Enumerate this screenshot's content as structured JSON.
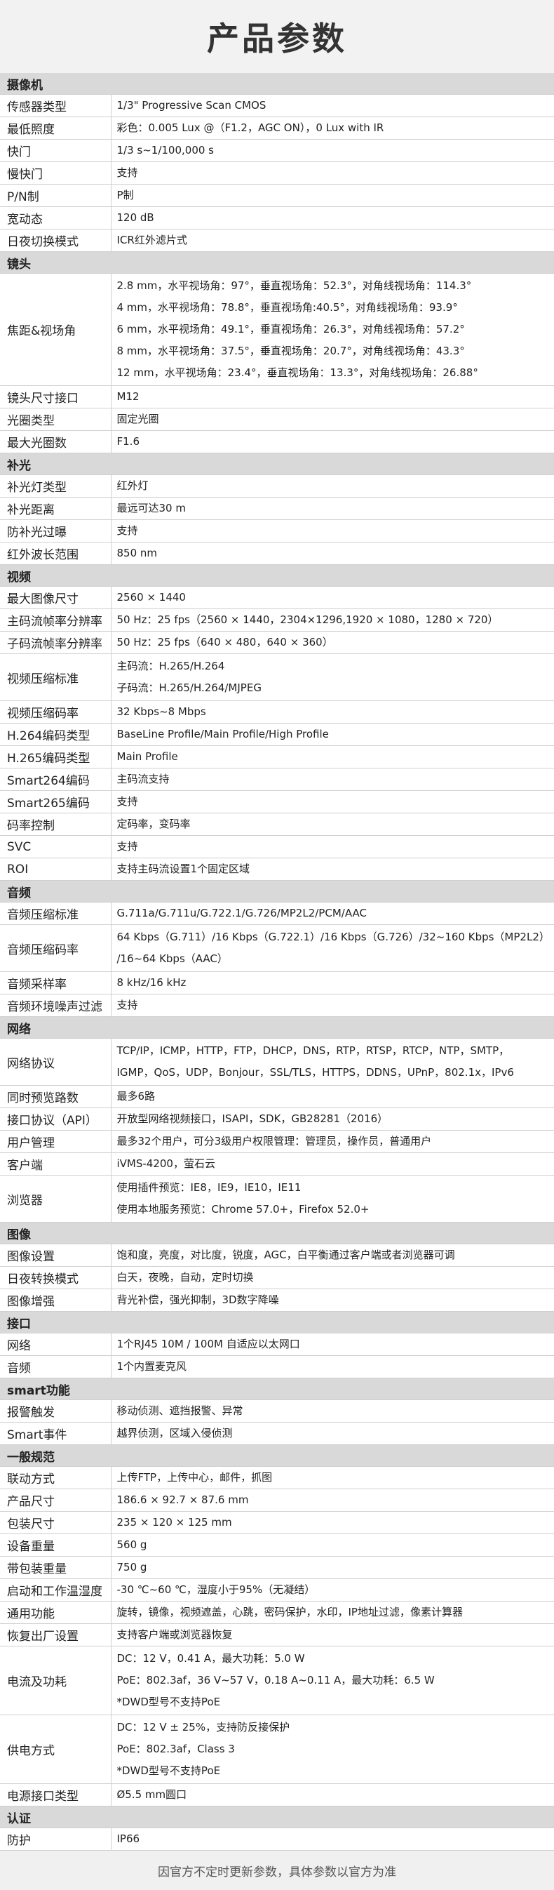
{
  "title": "产品参数",
  "footer": "因官方不定时更新参数，具体参数以官方为准",
  "sections": [
    {
      "name": "摄像机",
      "rows": [
        {
          "label": "传感器类型",
          "values": [
            "1/3\" Progressive Scan CMOS"
          ]
        },
        {
          "label": "最低照度",
          "values": [
            "彩色：0.005 Lux @（F1.2，AGC ON），0 Lux with IR"
          ]
        },
        {
          "label": "快门",
          "values": [
            "1/3 s~1/100,000 s"
          ]
        },
        {
          "label": "慢快门",
          "values": [
            "支持"
          ]
        },
        {
          "label": "P/N制",
          "values": [
            "P制"
          ]
        },
        {
          "label": "宽动态",
          "values": [
            "120 dB"
          ]
        },
        {
          "label": "日夜切换模式",
          "values": [
            "ICR红外滤片式"
          ]
        }
      ]
    },
    {
      "name": "镜头",
      "rows": [
        {
          "label": "焦距&视场角",
          "values": [
            "2.8 mm，水平视场角：97°，垂直视场角：52.3°，对角线视场角：114.3°",
            "4 mm，水平视场角：78.8°，垂直视场角:40.5°，对角线视场角：93.9°",
            "6 mm，水平视场角：49.1°，垂直视场角：26.3°，对角线视场角：57.2°",
            "8 mm，水平视场角：37.5°，垂直视场角：20.7°，对角线视场角：43.3°",
            "12 mm，水平视场角：23.4°，垂直视场角：13.3°，对角线视场角：26.88°"
          ]
        },
        {
          "label": "镜头尺寸接口",
          "values": [
            "M12"
          ]
        },
        {
          "label": "光圈类型",
          "values": [
            "固定光圈"
          ]
        },
        {
          "label": "最大光圈数",
          "values": [
            "F1.6"
          ]
        }
      ]
    },
    {
      "name": "补光",
      "rows": [
        {
          "label": "补光灯类型",
          "values": [
            "红外灯"
          ]
        },
        {
          "label": "补光距离",
          "values": [
            "最远可达30 m"
          ]
        },
        {
          "label": "防补光过曝",
          "values": [
            "支持"
          ]
        },
        {
          "label": "红外波长范围",
          "values": [
            "850 nm"
          ]
        }
      ]
    },
    {
      "name": "视频",
      "rows": [
        {
          "label": "最大图像尺寸",
          "values": [
            "2560 × 1440"
          ]
        },
        {
          "label": "主码流帧率分辨率",
          "values": [
            "50 Hz：25 fps（2560 × 1440，2304×1296,1920 × 1080，1280 × 720）"
          ]
        },
        {
          "label": "子码流帧率分辨率",
          "values": [
            "50 Hz：25 fps（640 × 480，640 × 360）"
          ]
        },
        {
          "label": "视频压缩标准",
          "values": [
            "主码流：H.265/H.264",
            "子码流：H.265/H.264/MJPEG"
          ]
        },
        {
          "label": "视频压缩码率",
          "values": [
            "32 Kbps~8 Mbps"
          ]
        },
        {
          "label": "H.264编码类型",
          "values": [
            "BaseLine Profile/Main Profile/High Profile"
          ]
        },
        {
          "label": "H.265编码类型",
          "values": [
            "Main Profile"
          ]
        },
        {
          "label": "Smart264编码",
          "values": [
            "主码流支持"
          ]
        },
        {
          "label": "Smart265编码",
          "values": [
            "支持"
          ]
        },
        {
          "label": "码率控制",
          "values": [
            "定码率，变码率"
          ]
        },
        {
          "label": "SVC",
          "values": [
            "支持"
          ]
        },
        {
          "label": "ROI",
          "values": [
            "支持主码流设置1个固定区域"
          ]
        }
      ]
    },
    {
      "name": "音频",
      "rows": [
        {
          "label": "音频压缩标准",
          "values": [
            "G.711a/G.711u/G.722.1/G.726/MP2L2/PCM/AAC"
          ]
        },
        {
          "label": "音频压缩码率",
          "values": [
            "64 Kbps（G.711）/16 Kbps（G.722.1）/16 Kbps（G.726）/32~160 Kbps（MP2L2）",
            "/16~64 Kbps（AAC）"
          ]
        },
        {
          "label": "音频采样率",
          "values": [
            "8 kHz/16 kHz"
          ]
        },
        {
          "label": "音频环境噪声过滤",
          "values": [
            "支持"
          ]
        }
      ]
    },
    {
      "name": "网络",
      "rows": [
        {
          "label": "网络协议",
          "values": [
            "TCP/IP，ICMP，HTTP，FTP，DHCP，DNS，RTP，RTSP，RTCP，NTP，SMTP，",
            "IGMP，QoS，UDP，Bonjour，SSL/TLS，HTTPS，DDNS，UPnP，802.1x，IPv6"
          ]
        },
        {
          "label": "同时预览路数",
          "values": [
            "最多6路"
          ]
        },
        {
          "label": "接口协议（API）",
          "values": [
            "开放型网络视频接口，ISAPI，SDK，GB28281（2016）"
          ]
        },
        {
          "label": "用户管理",
          "values": [
            "最多32个用户，可分3级用户权限管理：管理员，操作员，普通用户"
          ]
        },
        {
          "label": "客户端",
          "values": [
            "iVMS-4200，萤石云"
          ]
        },
        {
          "label": "浏览器",
          "values": [
            "使用插件预览：IE8，IE9，IE10，IE11",
            "使用本地服务预览：Chrome 57.0+，Firefox 52.0+"
          ]
        }
      ]
    },
    {
      "name": "图像",
      "rows": [
        {
          "label": "图像设置",
          "values": [
            "饱和度，亮度，对比度，锐度，AGC，白平衡通过客户端或者浏览器可调"
          ]
        },
        {
          "label": "日夜转换模式",
          "values": [
            "白天，夜晚，自动，定时切换"
          ]
        },
        {
          "label": "图像增强",
          "values": [
            "背光补偿，强光抑制，3D数字降噪"
          ]
        }
      ]
    },
    {
      "name": "接口",
      "rows": [
        {
          "label": "网络",
          "values": [
            "1个RJ45 10M / 100M  自适应以太网口"
          ]
        },
        {
          "label": "音频",
          "values": [
            "1个内置麦克风"
          ]
        }
      ]
    },
    {
      "name": "smart功能",
      "rows": [
        {
          "label": "报警触发",
          "values": [
            "移动侦测、遮挡报警、异常"
          ]
        },
        {
          "label": "Smart事件",
          "values": [
            "越界侦测，区域入侵侦测"
          ]
        }
      ]
    },
    {
      "name": "一般规范",
      "rows": [
        {
          "label": "联动方式",
          "values": [
            "上传FTP，上传中心，邮件，抓图"
          ]
        },
        {
          "label": "产品尺寸",
          "values": [
            "186.6 × 92.7 × 87.6 mm"
          ]
        },
        {
          "label": "包装尺寸",
          "values": [
            "235 × 120 × 125 mm"
          ]
        },
        {
          "label": "设备重量",
          "values": [
            "560 g"
          ]
        },
        {
          "label": "带包装重量",
          "values": [
            "750 g"
          ]
        },
        {
          "label": "启动和工作温湿度",
          "values": [
            "-30 ℃~60 ℃，湿度小于95%（无凝结）"
          ]
        },
        {
          "label": "通用功能",
          "values": [
            "旋转，镜像，视频遮盖，心跳，密码保护，水印，IP地址过滤，像素计算器"
          ]
        },
        {
          "label": "恢复出厂设置",
          "values": [
            "支持客户端或浏览器恢复"
          ]
        },
        {
          "label": "电流及功耗",
          "values": [
            "DC：12 V，0.41 A，最大功耗：5.0 W",
            "PoE：802.3af，36 V~57 V，0.18 A~0.11 A，最大功耗：6.5 W",
            "*DWD型号不支持PoE"
          ]
        },
        {
          "label": "供电方式",
          "values": [
            "DC：12 V ± 25%，支持防反接保护",
            "PoE：802.3af，Class 3",
            "*DWD型号不支持PoE"
          ]
        },
        {
          "label": "电源接口类型",
          "values": [
            "Ø5.5 mm圆口"
          ]
        }
      ]
    },
    {
      "name": "认证",
      "rows": [
        {
          "label": "防护",
          "values": [
            "IP66"
          ]
        }
      ]
    }
  ]
}
